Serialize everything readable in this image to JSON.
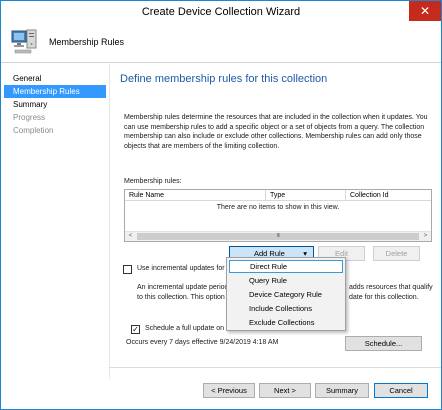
{
  "window": {
    "title": "Create Device Collection Wizard",
    "close_glyph": "✕"
  },
  "header": {
    "icon": "computer-icon",
    "title": "Membership Rules"
  },
  "sidebar": {
    "items": [
      {
        "label": "General",
        "state": "normal"
      },
      {
        "label": "Membership Rules",
        "state": "active"
      },
      {
        "label": "Summary",
        "state": "normal"
      },
      {
        "label": "Progress",
        "state": "disabled"
      },
      {
        "label": "Completion",
        "state": "disabled"
      }
    ]
  },
  "main": {
    "heading": "Define membership rules for this collection",
    "description": "Membership rules determine the resources that are included in the collection when it updates. You can use membership rules to add a specific object or a set of objects from a query. The collection membership can also include or exclude other collections. Membership rules can add only those objects that are members of the limiting collection.",
    "rules_label": "Membership rules:",
    "grid": {
      "columns": [
        "Rule Name",
        "Type",
        "Collection Id"
      ],
      "empty_text": "There are no items to show in this view.",
      "scroll_thumb": "III",
      "scroll_left": "<",
      "scroll_right": ">"
    },
    "add_rule_button": "Add Rule",
    "add_rule_arrow": "▾",
    "edit_button": "Edit",
    "delete_button": "Delete",
    "incremental_checkbox": {
      "label": "Use incremental updates for this",
      "checked": false
    },
    "incremental_desc_left_1": "An incremental update periodic",
    "incremental_desc_left_2": "to this collection. This option do",
    "incremental_desc_right_1": "adds resources that qualify",
    "incremental_desc_right_2": "date for this collection.",
    "schedule_checkbox": {
      "label": "Schedule a full update on this collection",
      "checked": true,
      "check_glyph": "✓"
    },
    "schedule_text": "Occurs every 7 days effective 9/24/2019 4:18 AM",
    "schedule_button": "Schedule..."
  },
  "dropdown": {
    "items": [
      {
        "label": "Direct Rule",
        "hover": true
      },
      {
        "label": "Query Rule",
        "hover": false
      },
      {
        "label": "Device Category Rule",
        "hover": false
      },
      {
        "label": "Include Collections",
        "hover": false
      },
      {
        "label": "Exclude Collections",
        "hover": false
      }
    ]
  },
  "footer": {
    "previous_button": "< Previous",
    "next_button": "Next >",
    "summary_button": "Summary",
    "cancel_button": "Cancel"
  },
  "colors": {
    "accent": "#3399ff",
    "heading": "#1e5aa8",
    "close": "#c42b1c",
    "border": "#1b86d4"
  }
}
